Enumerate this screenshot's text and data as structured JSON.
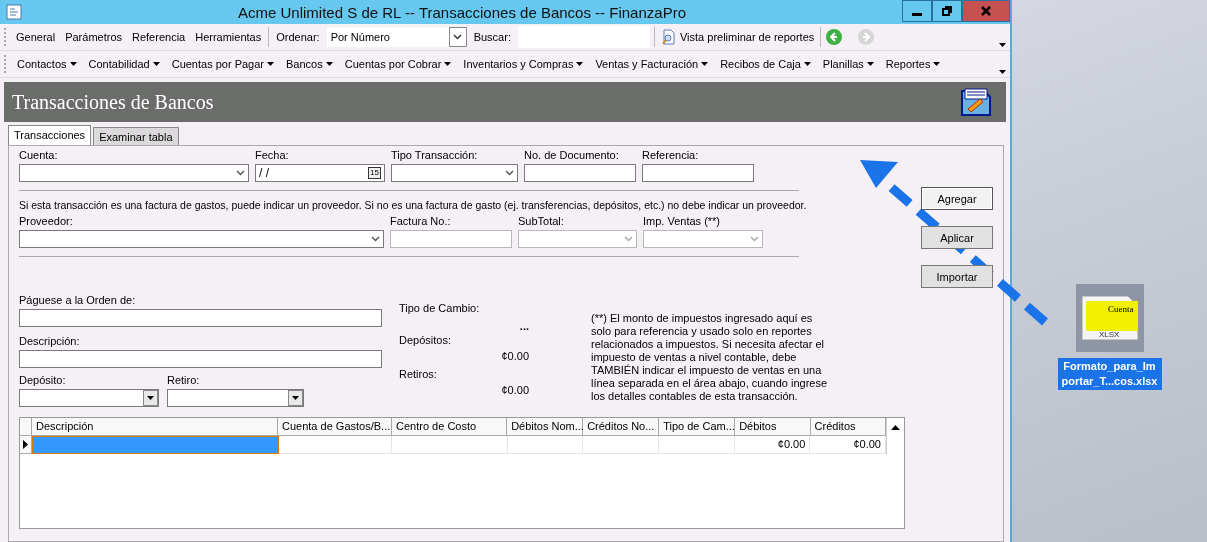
{
  "window": {
    "title": "Acme Unlimited S de RL -- Transacciones de Bancos -- FinanzaPro"
  },
  "toolbar": {
    "items": [
      "General",
      "Parámetros",
      "Referencia",
      "Herramientas"
    ],
    "sort_label": "Ordenar:",
    "sort_value": "Por Número",
    "search_label": "Buscar:",
    "preview_button": "Vista preliminar de reportes",
    "forward_disabled": true
  },
  "menus": [
    "Contactos",
    "Contabilidad",
    "Cuentas por Pagar",
    "Bancos",
    "Cuentas por Cobrar",
    "Inventarios y Compras",
    "Ventas y Facturación",
    "Recibos de Caja",
    "Planillas",
    "Reportes"
  ],
  "page_title": "Transacciones de Bancos",
  "tabs": [
    {
      "label": "Transacciones",
      "selected": true
    },
    {
      "label": "Examinar tabla",
      "selected": false
    }
  ],
  "row1": [
    {
      "label": "Cuenta:",
      "kind": "combo"
    },
    {
      "label": "Fecha:",
      "kind": "date",
      "value": " /  /",
      "calendar_text": "15"
    },
    {
      "label": "Tipo Transacción:",
      "kind": "combo"
    },
    {
      "label": "No. de Documento:",
      "kind": "text"
    },
    {
      "label": "Referencia:",
      "kind": "text"
    }
  ],
  "vendor_note": "Si esta transacción es una factura de gastos, puede indicar un proveedor. Si no es una factura de gasto (ej. transferencias, depósitos, etc.) no debe indicar un proveedor.",
  "row2": [
    {
      "label": "Proveedor:",
      "kind": "combo"
    },
    {
      "label": "Factura No.:",
      "kind": "text-disabled"
    },
    {
      "label": "SubTotal:",
      "kind": "combo-disabled"
    },
    {
      "label": "Imp. Ventas (**)",
      "kind": "combo-disabled"
    }
  ],
  "payee": {
    "label": "Páguese a la Orden de:"
  },
  "description": {
    "label": "Descripción:"
  },
  "deposit": {
    "label": "Depósito:"
  },
  "withdrawal": {
    "label": "Retiro:"
  },
  "exchange": {
    "label": "Tipo de Cambio:",
    "value": "..."
  },
  "deposits_total": {
    "label": "Depósitos:",
    "value": "¢0.00"
  },
  "withdrawals_total": {
    "label": "Retiros:",
    "value": "¢0.00"
  },
  "tax_note": "(**) El monto de impuestos ingresado aquí es solo para referencia y usado solo en reportes relacionados a impuestos. Si necesita afectar el impuesto de ventas a nivel contable, debe TAMBIÉN indicar el impuesto de ventas en una línea separada en el área abajo, cuando ingrese los detalles contables de esta transacción.",
  "buttons": [
    {
      "label": "Agregar",
      "default": true
    },
    {
      "label": "Aplicar",
      "default": false
    },
    {
      "label": "Importar",
      "default": false
    }
  ],
  "grid": {
    "columns": [
      "Descripción",
      "Cuenta de Gastos/B...",
      "Centro de Costo",
      "Débitos Nom...",
      "Créditos No...",
      "Tipo de Cam...",
      "Débitos",
      "Créditos"
    ],
    "rows": [
      {
        "selected": true,
        "cells": [
          "",
          "",
          "",
          "",
          "",
          "",
          "¢0.00",
          "¢0.00"
        ]
      }
    ]
  },
  "desktop_file": {
    "preview_text": "Cuenta",
    "type_label": "XLSX",
    "name": [
      "Formato_para_Im",
      "portar_T...cos.xlsx"
    ]
  }
}
